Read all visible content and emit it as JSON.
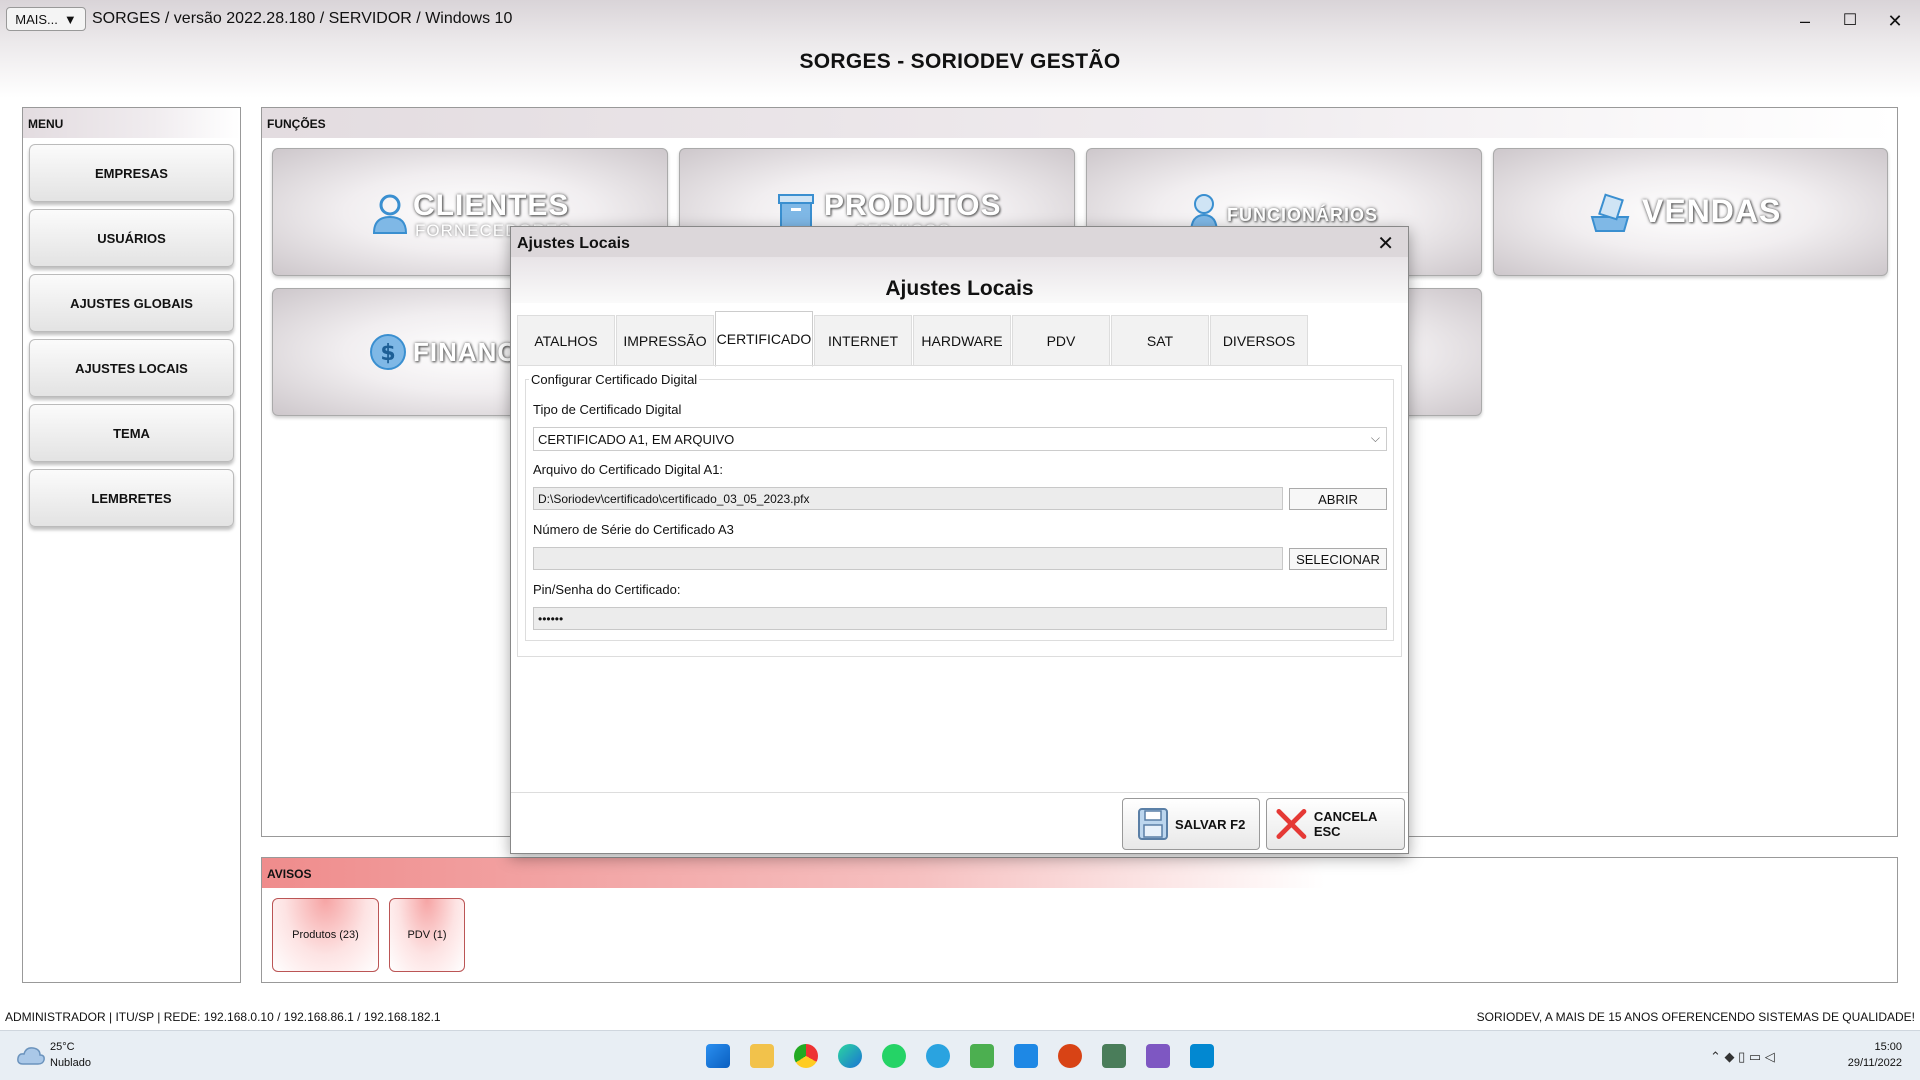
{
  "window": {
    "mais_label": "MAIS...",
    "mais_caret": "▼",
    "title": "SORGES / versão 2022.28.180 / SERVIDOR / Windows 10",
    "minimize": "–",
    "maximize": "☐",
    "close": "✕"
  },
  "app": {
    "title": "SORGES - SORIODEV GESTÃO"
  },
  "menu": {
    "header": "MENU",
    "items": [
      "EMPRESAS",
      "USUÁRIOS",
      "AJUSTES GLOBAIS",
      "AJUSTES LOCAIS",
      "TEMA",
      "LEMBRETES"
    ]
  },
  "funcoes": {
    "header": "FUNÇÕES",
    "tiles": {
      "clientes": {
        "label": "CLIENTES",
        "sub": "FORNECEDORES"
      },
      "produtos": {
        "label": "PRODUTOS",
        "sub": "SERVIÇOS"
      },
      "funcionarios": {
        "label": "FUNCIONÁRIOS"
      },
      "vendas": {
        "label": "VENDAS"
      },
      "financeiro": {
        "label": "FINANC"
      }
    }
  },
  "avisos": {
    "header": "AVISOS",
    "items": [
      "Produtos (23)",
      "PDV (1)"
    ]
  },
  "status": {
    "left": "ADMINISTRADOR |   ITU/SP |   REDE: 192.168.0.10 / 192.168.86.1 / 192.168.182.1",
    "right": "SORIODEV, A MAIS DE 15 ANOS OFERENCENDO SISTEMAS DE QUALIDADE!"
  },
  "taskbar": {
    "weather_temp": "25°C",
    "weather_desc": "Nublado",
    "time": "15:00",
    "date": "29/11/2022"
  },
  "dialog": {
    "title": "Ajustes Locais",
    "close": "✕",
    "heading": "Ajustes Locais",
    "tabs": [
      "ATALHOS",
      "IMPRESSÃO",
      "CERTIFICADO",
      "INTERNET",
      "HARDWARE",
      "PDV",
      "SAT",
      "DIVERSOS"
    ],
    "active_tab": "CERTIFICADO",
    "group_title": "Configurar Certificado Digital",
    "tipo_label": "Tipo de Certificado Digital",
    "tipo_value": "CERTIFICADO A1, EM ARQUIVO",
    "arquivo_label": "Arquivo do Certificado Digital A1:",
    "arquivo_value": "D:\\Soriodev\\certificado\\certificado_03_05_2023.pfx",
    "abrir_label": "ABRIR",
    "serie_label": "Número de Série do Certificado A3",
    "serie_value": "",
    "selecionar_label": "SELECIONAR",
    "pin_label": "Pin/Senha do Certificado:",
    "pin_value": "••••••",
    "salvar_label": "SALVAR F2",
    "cancela_label": "CANCELA ESC"
  }
}
